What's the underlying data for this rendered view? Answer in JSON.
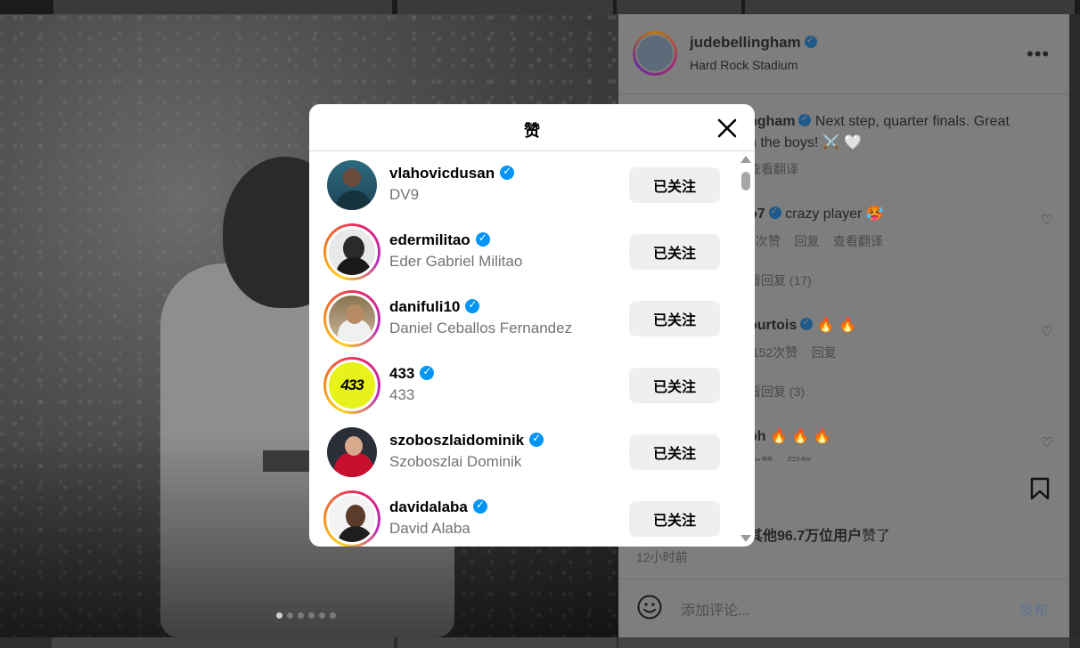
{
  "modal": {
    "title": "赞",
    "follow_label": "已关注",
    "users": [
      {
        "username": "vlahovicdusan",
        "fullname": "DV9",
        "avatar": "vlahovicdusan-avatar"
      },
      {
        "username": "edermilitao",
        "fullname": "Eder Gabriel Militao",
        "avatar": "edermilitao-avatar"
      },
      {
        "username": "danifuli10",
        "fullname": "Daniel Ceballos Fernandez",
        "avatar": "danifuli10-avatar"
      },
      {
        "username": "433",
        "fullname": "433",
        "avatar_text": "433"
      },
      {
        "username": "szoboszlaidominik",
        "fullname": "Szoboszlai Dominik",
        "avatar": "szoboszlaidominik-avatar"
      },
      {
        "username": "davidalaba",
        "fullname": "David Alaba",
        "avatar": "davidalaba-avatar"
      }
    ]
  },
  "post": {
    "author": "judebellingham",
    "location": "Hard Rock Stadium",
    "more_icon": "more-horizontal-icon",
    "caption_author_fragment": "ngham",
    "caption_line1": "Next step, quarter finals. Great",
    "caption_line2": "n the boys! ⚔️ 🤍",
    "translate_fragment": "查看翻译",
    "comments": [
      {
        "author_fragment": "o7",
        "text": "crazy player 🥵",
        "likes_fragment": "0次赞",
        "reply": "回复",
        "translate": "查看翻译",
        "view_replies": "看回复 (17)"
      },
      {
        "author_fragment": "ourtois",
        "text": "🔥 🔥",
        "likes_fragment": ",152次赞",
        "reply": "回复",
        "view_replies": "看回复 (3)"
      },
      {
        "author_fragment": "ph",
        "text": "🔥 🔥 🔥",
        "likes_fragment": "次赞",
        "reply": "回复"
      }
    ],
    "likes_summary_bold": "其他96.7万位用户",
    "likes_summary_rest": "赞了",
    "time_ago": "12小时前",
    "comment_placeholder": "添加评论...",
    "post_button": "发布"
  },
  "carousel": {
    "count": 6,
    "active_index": 0
  },
  "colors": {
    "verified": "#0095f6",
    "follow_button_bg": "#efefef",
    "backdrop": "#7e7e7e"
  }
}
